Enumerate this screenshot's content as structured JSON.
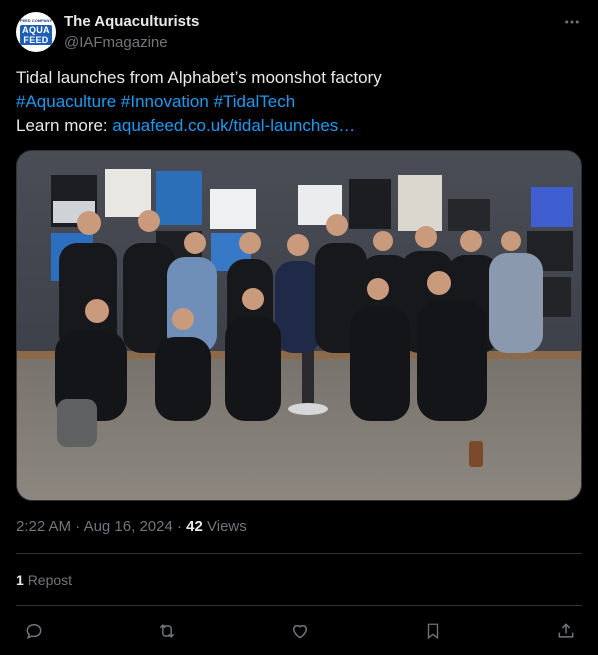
{
  "author": {
    "display_name": "The Aquaculturists",
    "handle": "@IAFmagazine",
    "avatar": {
      "top_text": "FEED COMPANY",
      "logo_text": "AQUA FEED"
    }
  },
  "tweet": {
    "text_line1": "Tidal launches from Alphabet’s moonshot factory",
    "hashtags": [
      "#Aquaculture",
      "#Innovation",
      "#TidalTech"
    ],
    "learn_more_label": "Learn more:",
    "link_text": "aquafeed.co.uk/tidal-launches…"
  },
  "media": {
    "icon": "photo-group-team"
  },
  "meta": {
    "time": "2:22 AM",
    "date": "Aug 16, 2024",
    "views_count": "42",
    "views_label": "Views"
  },
  "engagement": {
    "reposts_count": "1",
    "reposts_label": "Repost"
  },
  "actions": [
    "reply-icon",
    "repost-icon",
    "like-icon",
    "bookmark-icon",
    "share-icon"
  ],
  "colors": {
    "background": "#000000",
    "text": "#e7e9ea",
    "secondary": "#71767b",
    "link": "#1d9bf0",
    "border": "#2f3336"
  }
}
